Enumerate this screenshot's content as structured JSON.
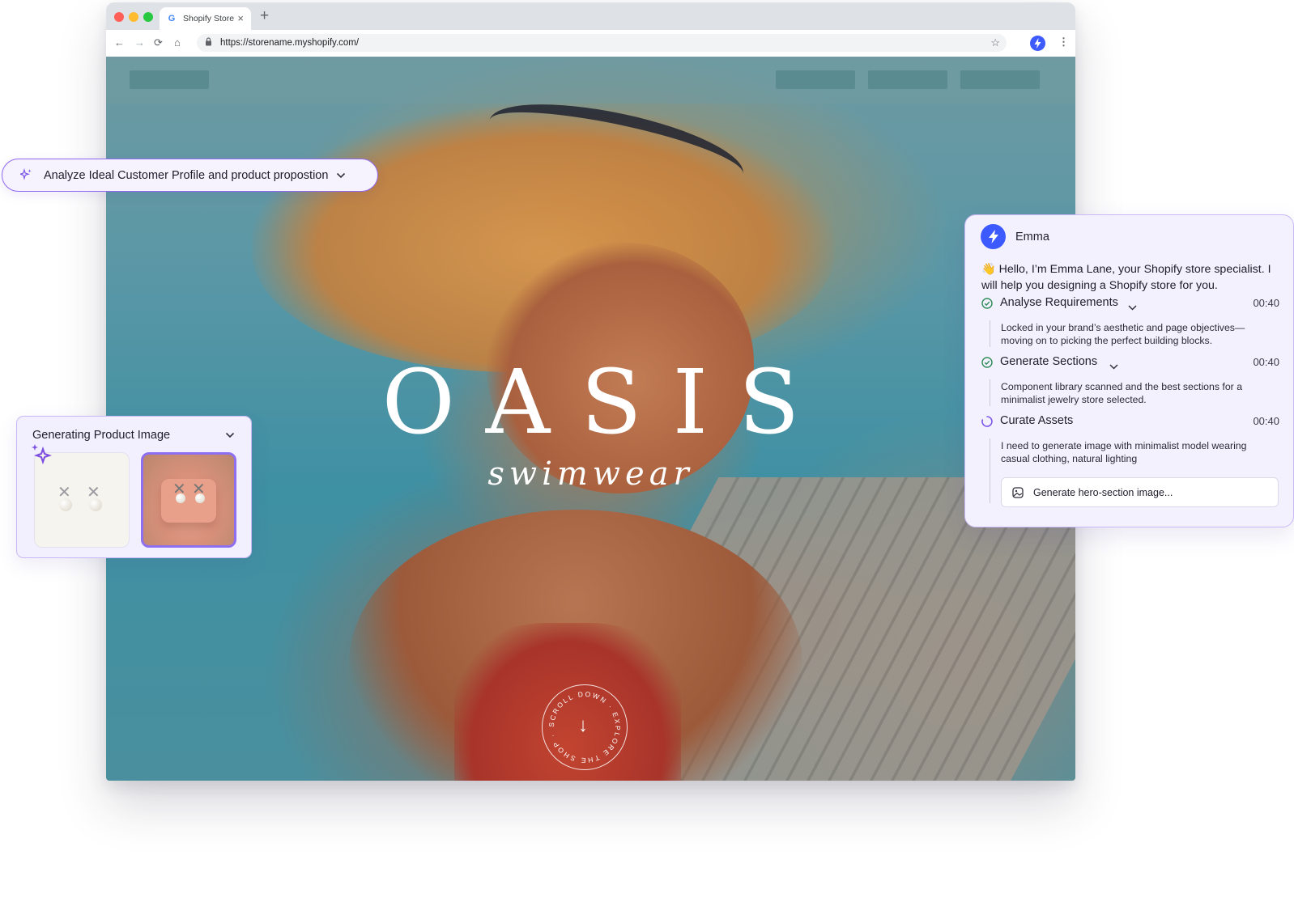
{
  "browser": {
    "tab_title": "Shopify Store",
    "tab_close": "×",
    "new_tab": "+",
    "url": "https://storename.myshopify.com/",
    "back": "←",
    "forward": "→",
    "reload": "⟳",
    "home": "⌂",
    "menu": "⋮",
    "bookmark": "☆"
  },
  "hero": {
    "brand": "OASIS",
    "tagline": "swimwear",
    "scroll_text": "SCROLL DOWN · EXPLORE THE SHOP ·",
    "scroll_arrow": "↓"
  },
  "task_pill": {
    "label": "Analyze Ideal Customer Profile and  product propostion",
    "chevron": "⌄"
  },
  "product_image_panel": {
    "title": "Generating Product Image",
    "chevron": "⌄"
  },
  "assistant": {
    "name": "Emma",
    "greeting": "👋 Hello, I’m Emma Lane, your Shopify store specialist. I will help you designing a Shopify store for you.",
    "steps": [
      {
        "label": "Analyse Requirements",
        "time": "00:40",
        "description": "Locked in your brand’s aesthetic and page objectives—moving on to picking the perfect building blocks.",
        "status": "done"
      },
      {
        "label": "Generate Sections",
        "time": "00:40",
        "description": "Component library scanned and the best sections for a minimalist jewelry store selected.",
        "status": "done"
      },
      {
        "label": "Curate Assets",
        "time": "00:40",
        "description": "I need to generate image with minimalist model wearing casual clothing, natural lighting",
        "status": "in-progress"
      }
    ],
    "action_label": "Generate hero-section image...",
    "chevron": "⌄"
  },
  "colors": {
    "accent": "#8f68f0",
    "brand_blue": "#3d5afe",
    "success": "#2e8b57"
  }
}
